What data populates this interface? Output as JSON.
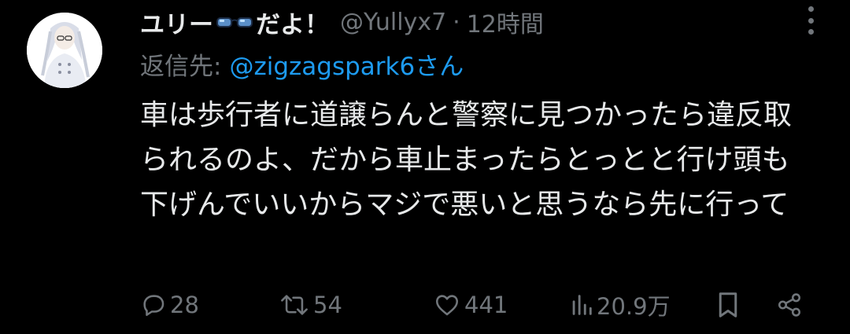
{
  "tweet": {
    "display_name_prefix": "ユリー",
    "display_name_suffix": "だよ！",
    "handle": "@Yullyx7",
    "separator": "·",
    "time": "12時間",
    "reply_label": "返信先:",
    "reply_to": "@zigzagspark6さん",
    "text": "車は歩行者に道譲らんと警察に見つかったら違反取られるのよ、だから車止まったらとっとと行け頭も下げんでいいからマジで悪いと思うなら先に行って"
  },
  "actions": {
    "replies": "28",
    "reposts": "54",
    "likes": "441",
    "views": "20.9万"
  },
  "colors": {
    "background": "#000000",
    "text": "#e7e9ea",
    "muted": "#71767b",
    "link": "#1d9bf0"
  }
}
